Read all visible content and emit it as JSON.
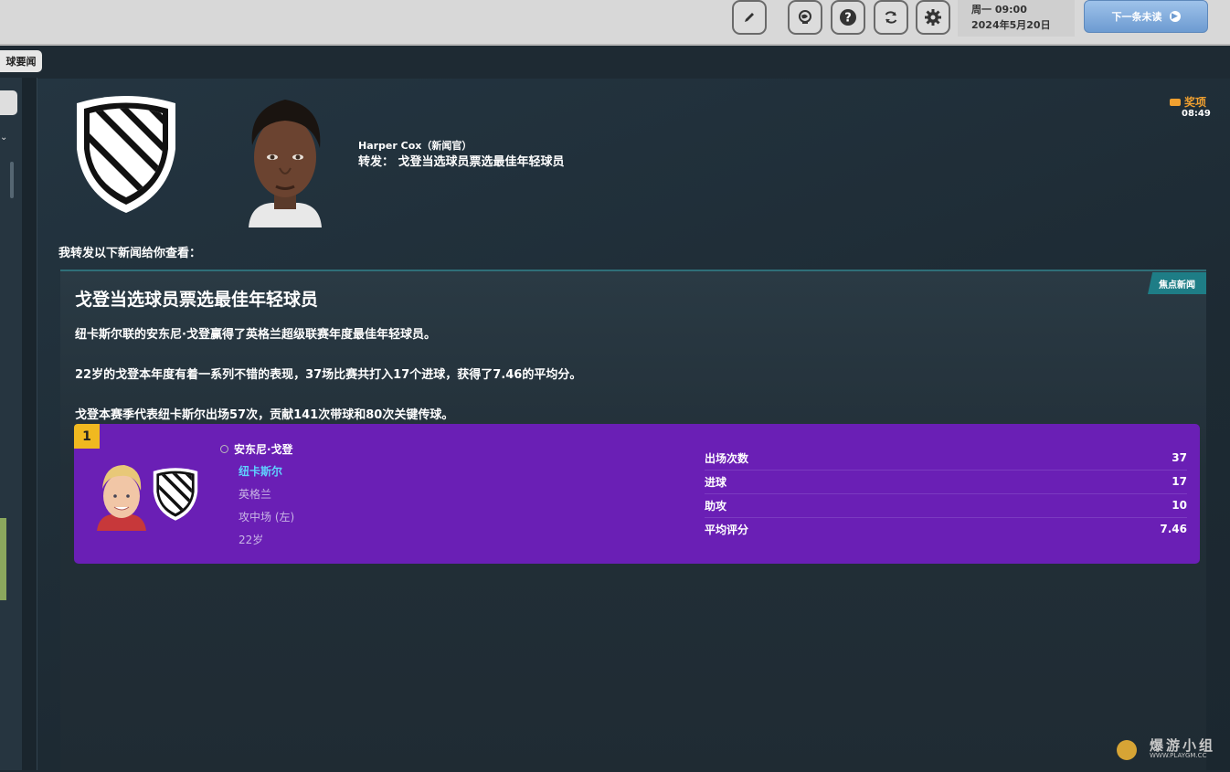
{
  "toolbar": {
    "icons": [
      "pencil-icon",
      "globe-icon",
      "help-icon",
      "refresh-icon",
      "gear-icon"
    ],
    "date_line1": "周一 09:00",
    "date_line2": "2024年5月20日",
    "next_unread": "下一条未读"
  },
  "sidebar": {
    "tab_label": "球要闻"
  },
  "message": {
    "sender": "Harper Cox（新闻官）",
    "subject": "转发：  戈登当选球员票选最佳年轻球员",
    "award_label": "奖项",
    "time": "08:49",
    "intro": "我转发以下新闻给你查看："
  },
  "news": {
    "tag": "焦点新闻",
    "headline": "戈登当选球员票选最佳年轻球员",
    "paragraphs": [
      "纽卡斯尔联的安东尼·戈登赢得了英格兰超级联赛年度最佳年轻球员。",
      "22岁的戈登本年度有着一系列不错的表现，37场比赛共打入17个进球，获得了7.46的平均分。",
      "戈登本赛季代表纽卡斯尔出场57次，贡献141次带球和80次关键传球。"
    ]
  },
  "player": {
    "rank": "1",
    "name": "安东尼·戈登",
    "club": "纽卡斯尔",
    "nation": "英格兰",
    "position": "攻中场 (左)",
    "age": "22岁",
    "stats": [
      {
        "label": "出场次数",
        "value": "37"
      },
      {
        "label": "进球",
        "value": "17"
      },
      {
        "label": "助攻",
        "value": "10"
      },
      {
        "label": "平均评分",
        "value": "7.46"
      }
    ]
  },
  "watermark": {
    "title": "爆游小组",
    "url": "WWW.PLAYGM.CC"
  },
  "colors": {
    "purple_box": "#6a1fb5",
    "rank_badge": "#f0b920",
    "news_tag": "#1e7d86",
    "award": "#f0a030"
  }
}
